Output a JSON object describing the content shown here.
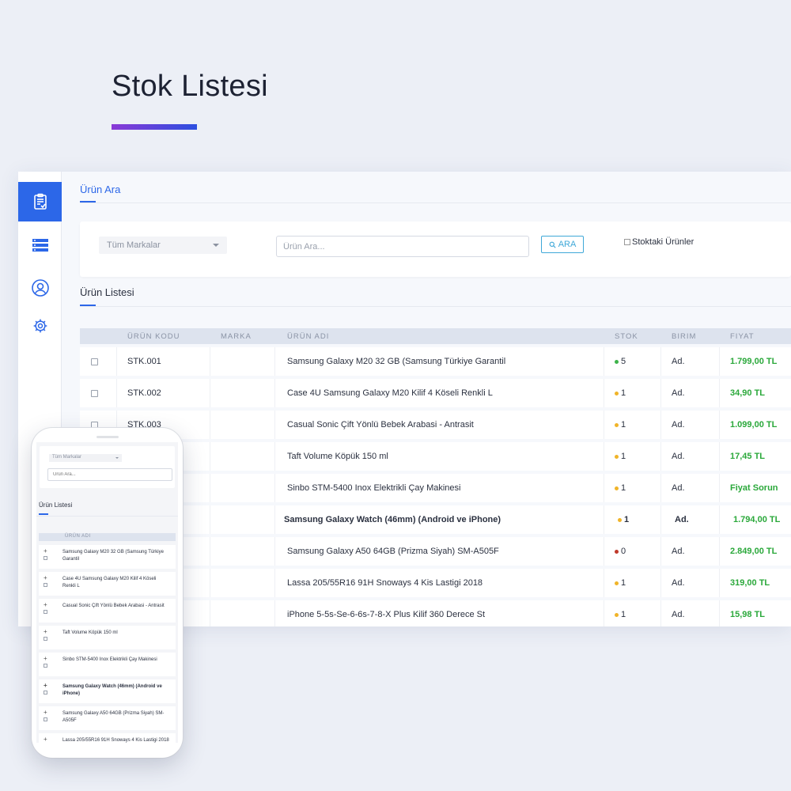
{
  "page": {
    "title": "Stok Listesi"
  },
  "colors": {
    "accent": "#2c67e8",
    "price": "#2aa83a",
    "dot_green": "#3db34a",
    "dot_yellow": "#f0b429",
    "dot_red": "#c0392b"
  },
  "sidebar": {
    "items": [
      {
        "icon": "clipboard-icon",
        "active": true
      },
      {
        "icon": "server-icon",
        "active": false
      },
      {
        "icon": "user-icon",
        "active": false
      },
      {
        "icon": "gear-icon",
        "active": false
      }
    ]
  },
  "search": {
    "tab": "Ürün Ara",
    "brand_select": "Tüm Markalar",
    "placeholder": "Ürün Ara...",
    "button": "ARA",
    "stock_only": "Stoktaki Ürünler"
  },
  "list": {
    "tab": "Ürün Listesi",
    "columns": [
      "ÜRÜN KODU",
      "MARKA",
      "ÜRÜN ADI",
      "STOK",
      "BIRIM",
      "FIYAT"
    ],
    "rows": [
      {
        "code": "STK.001",
        "brand": "",
        "name": "Samsung Galaxy M20 32 GB (Samsung Türkiye Garantil",
        "stock": "5",
        "status": "green",
        "unit": "Ad.",
        "price": "1.799,00 TL",
        "bold": false
      },
      {
        "code": "STK.002",
        "brand": "",
        "name": "Case 4U Samsung Galaxy M20 Kilif 4 Köseli Renkli L",
        "stock": "1",
        "status": "yellow",
        "unit": "Ad.",
        "price": "34,90 TL",
        "bold": false
      },
      {
        "code": "STK.003",
        "brand": "",
        "name": "Casual Sonic Çift Yönlü Bebek Arabasi - Antrasit",
        "stock": "1",
        "status": "yellow",
        "unit": "Ad.",
        "price": "1.099,00 TL",
        "bold": false
      },
      {
        "code": "",
        "brand": "",
        "name": "Taft Volume Köpük 150 ml",
        "stock": "1",
        "status": "yellow",
        "unit": "Ad.",
        "price": "17,45 TL",
        "bold": false
      },
      {
        "code": "",
        "brand": "",
        "name": "Sinbo STM-5400 Inox Elektrikli Çay Makinesi",
        "stock": "1",
        "status": "yellow",
        "unit": "Ad.",
        "price": "Fiyat Sorun",
        "bold": false
      },
      {
        "code": "",
        "brand": "",
        "name": "Samsung Galaxy Watch (46mm) (Android ve iPhone)",
        "stock": "1",
        "status": "yellow",
        "unit": "Ad.",
        "price": "1.794,00 TL",
        "bold": true
      },
      {
        "code": "",
        "brand": "",
        "name": "Samsung Galaxy A50 64GB (Prizma Siyah) SM-A505F",
        "stock": "0",
        "status": "red",
        "unit": "Ad.",
        "price": "2.849,00 TL",
        "bold": false
      },
      {
        "code": "",
        "brand": "",
        "name": "Lassa 205/55R16 91H Snoways 4 Kis Lastigi 2018",
        "stock": "1",
        "status": "yellow",
        "unit": "Ad.",
        "price": "319,00 TL",
        "bold": false
      },
      {
        "code": "",
        "brand": "",
        "name": "iPhone 5-5s-Se-6-6s-7-8-X Plus Kilif 360 Derece St",
        "stock": "1",
        "status": "yellow",
        "unit": "Ad.",
        "price": "15,98 TL",
        "bold": false
      }
    ]
  },
  "mobile": {
    "brand_select": "Tüm Markalar",
    "placeholder": "Ürün Ara...",
    "tab": "Ürün Listesi",
    "column": "ÜRÜN ADI",
    "rows": [
      {
        "name": "Samsung Galaxy M20 32 GB (Samsung Türkiye Garantil",
        "bold": false
      },
      {
        "name": "Case 4U Samsung Galaxy M20 Kilif 4 Köseli Renkli L",
        "bold": false
      },
      {
        "name": "Casual Sonic Çift Yönlü Bebek Arabasi - Antrasit",
        "bold": false
      },
      {
        "name": "Taft Volume Köpük 150 ml",
        "bold": false
      },
      {
        "name": "Sinbo STM-5400 Inox Elektrikli Çay Makinesi",
        "bold": false
      },
      {
        "name": "Samsung Galaxy Watch (46mm) (Android ve iPhone)",
        "bold": true
      },
      {
        "name": "Samsung Galaxy A50 64GB (Prizma Siyah) SM-A505F",
        "bold": false
      },
      {
        "name": "Lassa 205/55R16 91H Snoways 4 Kis Lastigi 2018",
        "bold": false
      }
    ]
  }
}
